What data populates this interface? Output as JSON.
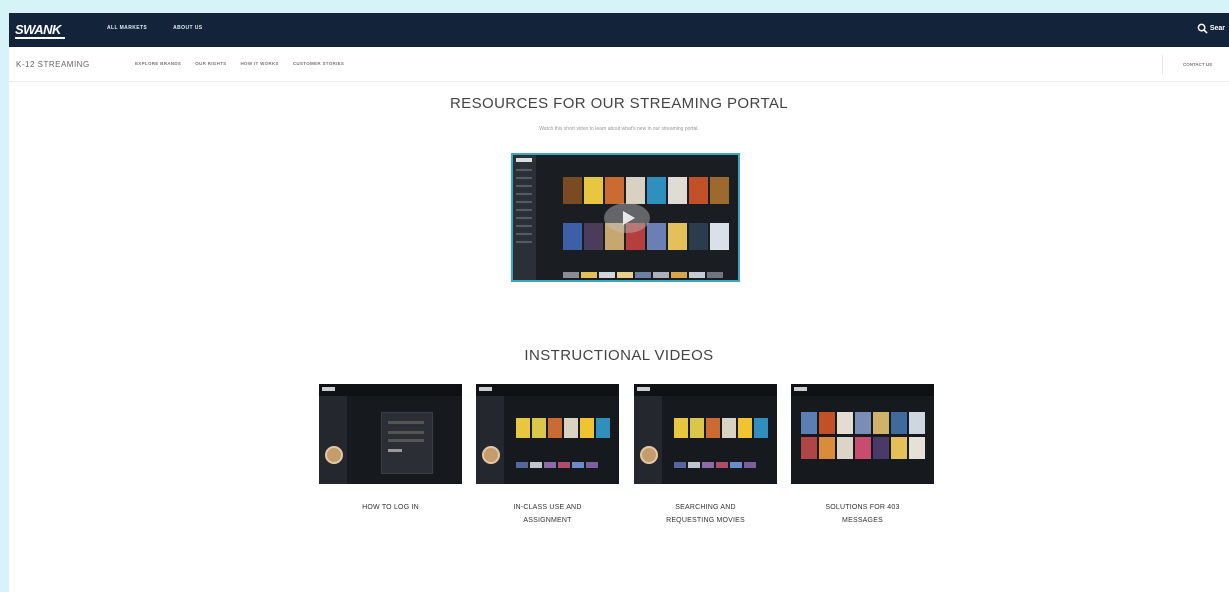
{
  "header": {
    "logo": "SWANK",
    "nav": [
      "ALL MARKETS",
      "ABOUT US"
    ],
    "search_label": "Sear"
  },
  "subnav": {
    "title": "K-12 STREAMING",
    "links": [
      "EXPLORE BRANDS",
      "OUR RIGHTS",
      "HOW IT WORKS",
      "CUSTOMER STORIES"
    ],
    "contact": "CONTACT US"
  },
  "resources": {
    "heading": "RESOURCES FOR OUR STREAMING PORTAL",
    "subtext": "Watch this short video to learn about what's new in our streaming portal."
  },
  "instructional": {
    "heading": "INSTRUCTIONAL VIDEOS",
    "videos": [
      {
        "line1": "HOW TO LOG IN",
        "line2": ""
      },
      {
        "line1": "IN-CLASS USE AND",
        "line2": "ASSIGNMENT"
      },
      {
        "line1": "SEARCHING AND",
        "line2": "REQUESTING MOVIES"
      },
      {
        "line1": "SOLUTIONS FOR 403",
        "line2": "MESSAGES"
      }
    ]
  },
  "colors": {
    "topbar": "#13233a",
    "accent": "#3aa7bf",
    "background": "#d6f3f7"
  }
}
